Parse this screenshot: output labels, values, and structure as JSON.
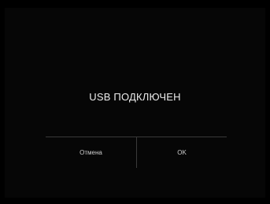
{
  "dialog": {
    "message": "USB ПОДКЛЮЧЕН",
    "cancel_label": "Отмена",
    "ok_label": "OK"
  }
}
